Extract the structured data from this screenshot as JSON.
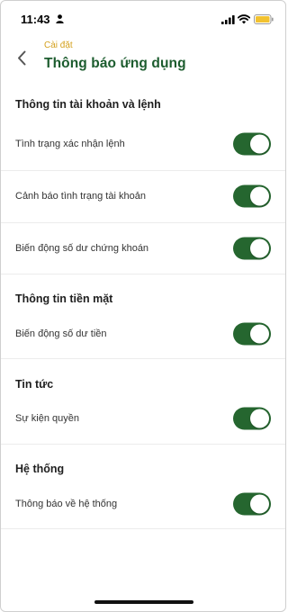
{
  "status_bar": {
    "time": "11:43"
  },
  "header": {
    "breadcrumb": "Cài đặt",
    "title": "Thông báo ứng dụng"
  },
  "sections": [
    {
      "title": "Thông tin tài khoản và lệnh",
      "items": [
        {
          "label": "Tình trạng xác nhận lệnh",
          "enabled": true
        },
        {
          "label": "Cảnh báo tình trạng tài khoản",
          "enabled": true
        },
        {
          "label": "Biến động số dư chứng khoán",
          "enabled": true
        }
      ]
    },
    {
      "title": "Thông tin tiền mặt",
      "items": [
        {
          "label": "Biến động số dư tiền",
          "enabled": true
        }
      ]
    },
    {
      "title": "Tin tức",
      "items": [
        {
          "label": "Sự kiện quyền",
          "enabled": true
        }
      ]
    },
    {
      "title": "Hệ thống",
      "items": [
        {
          "label": "Thông báo về hệ thống",
          "enabled": true
        }
      ]
    }
  ],
  "colors": {
    "accent": "#25662f",
    "title": "#1c5c2e",
    "breadcrumb": "#d4a11e"
  }
}
